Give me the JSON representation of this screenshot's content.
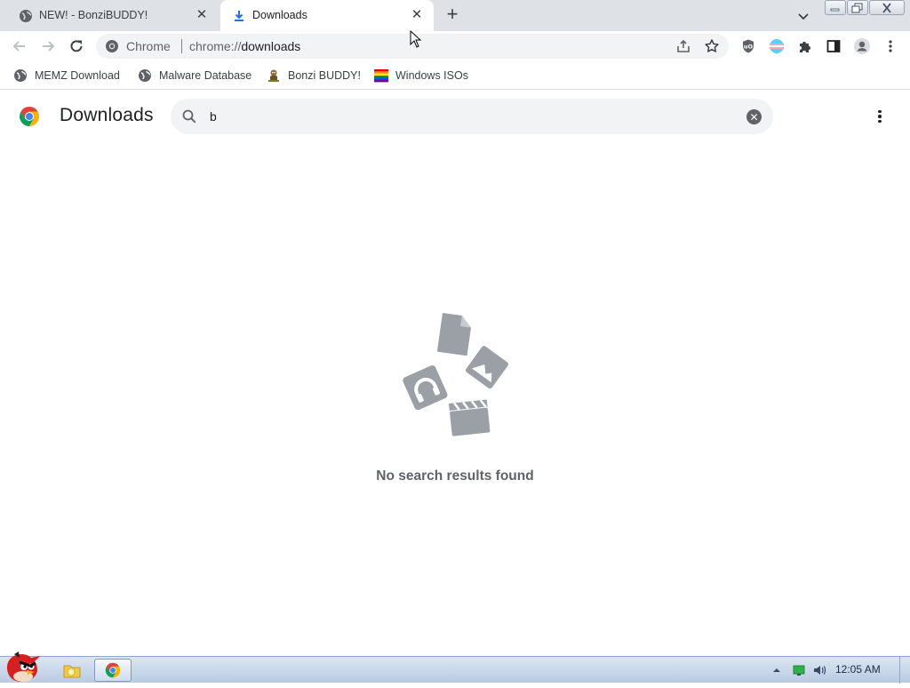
{
  "tabs": [
    {
      "title": "NEW! - BonziBUDDY!",
      "icon": "globe-icon",
      "close": "✕"
    },
    {
      "title": "Downloads",
      "icon": "download-icon",
      "close": "✕"
    }
  ],
  "new_tab": "+",
  "omnibox": {
    "chip": "Chrome",
    "url_scheme": "chrome://",
    "url_host": "downloads"
  },
  "bookmarks": [
    {
      "label": "MEMZ Download",
      "icon": "globe-icon"
    },
    {
      "label": "Malware Database",
      "icon": "globe-icon"
    },
    {
      "label": "Bonzi BUDDY!",
      "icon": "bonzi-icon"
    },
    {
      "label": "Windows ISOs",
      "icon": "rainbow-flag-icon"
    }
  ],
  "downloads": {
    "title": "Downloads",
    "search_value": "b",
    "empty_message": "No search results found"
  },
  "taskbar": {
    "clock": "12:05 AM"
  },
  "colors": {
    "tab_strip": "#dee1e6",
    "omnibox_bg": "#f1f3f4",
    "empty_icon": "#9aa0a6",
    "taskbar_top": "#dce6f2",
    "taskbar_bottom": "#b9cbe2"
  }
}
